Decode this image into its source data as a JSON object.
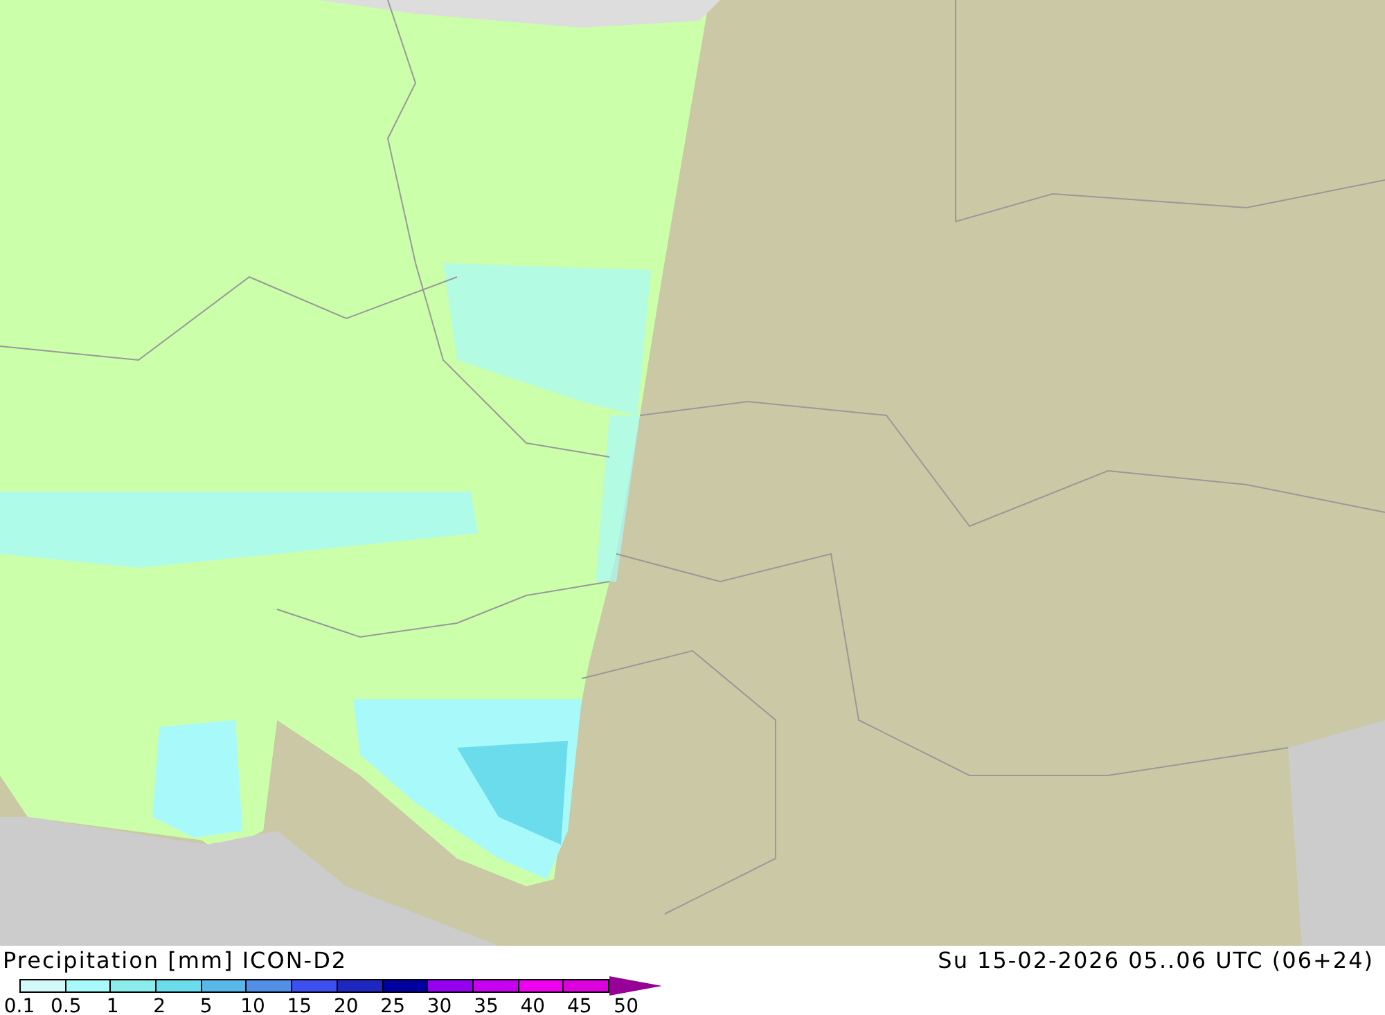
{
  "map": {
    "title": "Precipitation [mm] ICON-D2",
    "valid_time": "Su 15-02-2026 05..06 UTC (06+24)"
  },
  "legend": {
    "bins": [
      {
        "color": "#d2f8f8"
      },
      {
        "color": "#a8fafa"
      },
      {
        "color": "#8cebeb"
      },
      {
        "color": "#6adcec"
      },
      {
        "color": "#5ab8e8"
      },
      {
        "color": "#5290e8"
      },
      {
        "color": "#3c50f0"
      },
      {
        "color": "#1e28c0"
      },
      {
        "color": "#0000a0"
      },
      {
        "color": "#9600f0"
      },
      {
        "color": "#c800f0"
      },
      {
        "color": "#f000f0"
      },
      {
        "color": "#dc00dc"
      },
      {
        "color": "#960096"
      }
    ],
    "ticks": [
      "0.1",
      "0.5",
      "1",
      "2",
      "5",
      "10",
      "15",
      "20",
      "25",
      "30",
      "35",
      "40",
      "45",
      "50"
    ]
  }
}
